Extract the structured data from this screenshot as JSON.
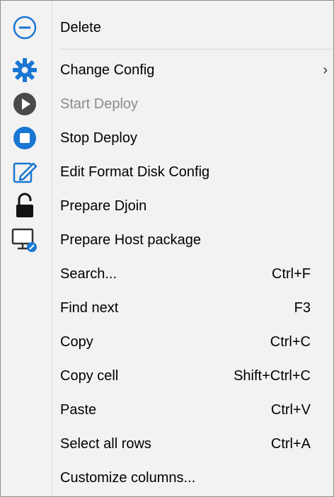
{
  "colors": {
    "accent_blue": "#1976d2",
    "disabled_gray": "#8b8b8b",
    "dark_icon": "#4a4a4a",
    "black_icon": "#111111"
  },
  "menu": {
    "items": [
      {
        "label": "Delete",
        "icon": "minus-circle-icon",
        "shortcut": "",
        "enabled": true
      },
      {
        "label": "Change Config",
        "icon": "gear-icon",
        "shortcut": "",
        "submenu": true,
        "enabled": true
      },
      {
        "label": "Start Deploy",
        "icon": "play-icon",
        "shortcut": "",
        "enabled": false
      },
      {
        "label": "Stop Deploy",
        "icon": "stop-icon",
        "shortcut": "",
        "enabled": true
      },
      {
        "label": "Edit Format Disk Config",
        "icon": "edit-icon",
        "shortcut": "",
        "enabled": true
      },
      {
        "label": "Prepare Djoin",
        "icon": "unlock-icon",
        "shortcut": "",
        "enabled": true
      },
      {
        "label": "Prepare Host package",
        "icon": "monitor-icon",
        "shortcut": "",
        "enabled": true
      },
      {
        "label": "Search...",
        "icon": "",
        "shortcut": "Ctrl+F",
        "enabled": true
      },
      {
        "label": "Find next",
        "icon": "",
        "shortcut": "F3",
        "enabled": true
      },
      {
        "label": "Copy",
        "icon": "",
        "shortcut": "Ctrl+C",
        "enabled": true
      },
      {
        "label": "Copy cell",
        "icon": "",
        "shortcut": "Shift+Ctrl+C",
        "enabled": true
      },
      {
        "label": "Paste",
        "icon": "",
        "shortcut": "Ctrl+V",
        "enabled": true
      },
      {
        "label": "Select all rows",
        "icon": "",
        "shortcut": "Ctrl+A",
        "enabled": true
      },
      {
        "label": "Customize columns...",
        "icon": "",
        "shortcut": "",
        "enabled": true
      }
    ],
    "submenu_arrow": "›"
  }
}
